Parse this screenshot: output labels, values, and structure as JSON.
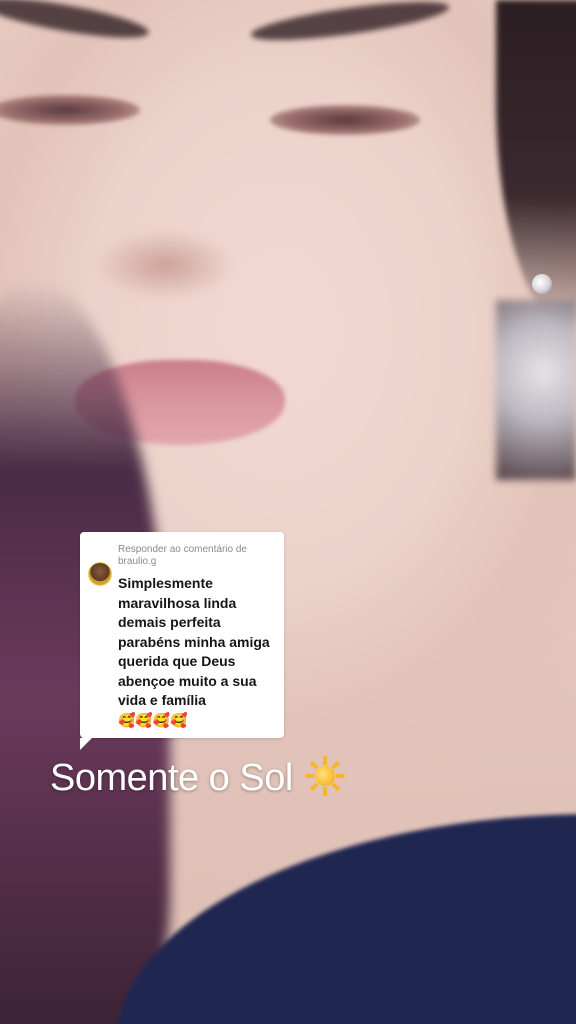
{
  "reply": {
    "header": "Responder ao comentário de braulio.g",
    "body": "Simplesmente maravilhosa linda demais perfeita parabéns minha amiga querida que Deus abençoe muito a sua vida e família",
    "emojis": "🥰🥰🥰🥰"
  },
  "caption": {
    "text": "Somente o Sol",
    "icon": "sun-icon"
  }
}
